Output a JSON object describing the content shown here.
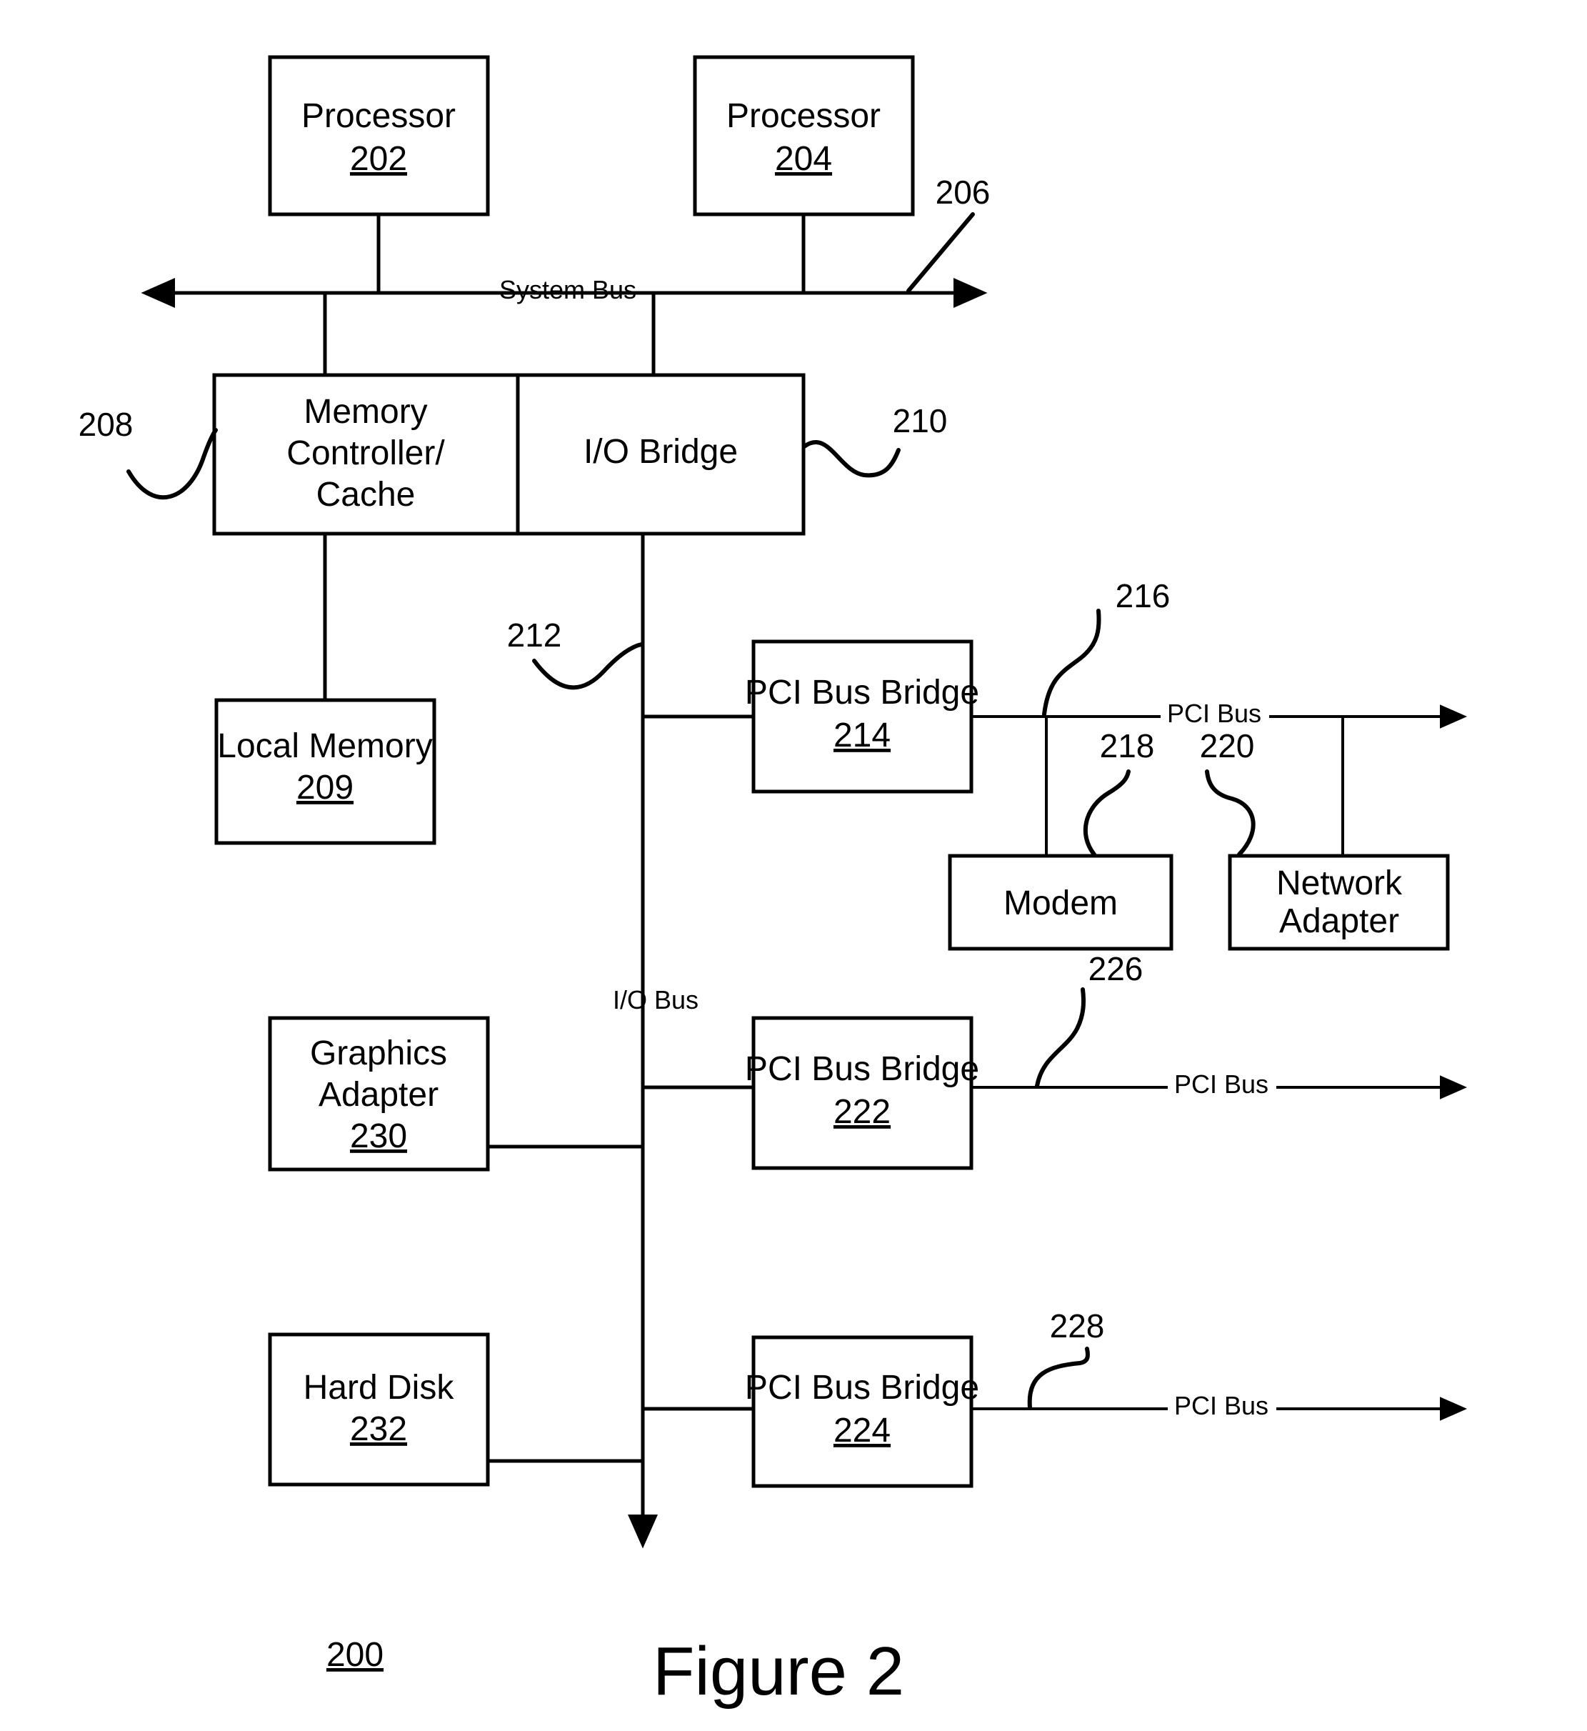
{
  "figure": {
    "caption": "Figure 2",
    "system_ref": "200"
  },
  "blocks": [
    {
      "id": "processor-202",
      "label": "Processor",
      "ref": "202"
    },
    {
      "id": "processor-204",
      "label": "Processor",
      "ref": "204"
    },
    {
      "id": "memory-controller-cache",
      "label_line1": "Memory",
      "label_line2": "Controller/",
      "label_line3": "Cache",
      "ref": "208"
    },
    {
      "id": "io-bridge",
      "label": "I/O Bridge",
      "ref": "210"
    },
    {
      "id": "local-memory",
      "label": "Local Memory",
      "ref": "209"
    },
    {
      "id": "pci-bus-bridge-214",
      "label": "PCI Bus Bridge",
      "ref": "214"
    },
    {
      "id": "modem",
      "label": "Modem",
      "ref": "218"
    },
    {
      "id": "network-adapter",
      "label_line1": "Network",
      "label_line2": "Adapter",
      "ref": "220"
    },
    {
      "id": "graphics-adapter",
      "label_line1": "Graphics",
      "label_line2": "Adapter",
      "ref": "230"
    },
    {
      "id": "pci-bus-bridge-222",
      "label": "PCI Bus Bridge",
      "ref": "222"
    },
    {
      "id": "hard-disk",
      "label": "Hard Disk",
      "ref": "232"
    },
    {
      "id": "pci-bus-bridge-224",
      "label": "PCI Bus Bridge",
      "ref": "224"
    }
  ],
  "buses": {
    "system_bus": {
      "label": "System Bus",
      "ref": "206"
    },
    "io_bus": {
      "label": "I/O Bus",
      "ref": "212"
    },
    "pci_bus_top": {
      "label": "PCI Bus",
      "ref": "216"
    },
    "pci_bus_middle": {
      "label": "PCI Bus",
      "ref": "226"
    },
    "pci_bus_bottom": {
      "label": "PCI Bus",
      "ref": "228"
    }
  },
  "colors": {
    "ink": "#000000",
    "paper": "#ffffff"
  }
}
